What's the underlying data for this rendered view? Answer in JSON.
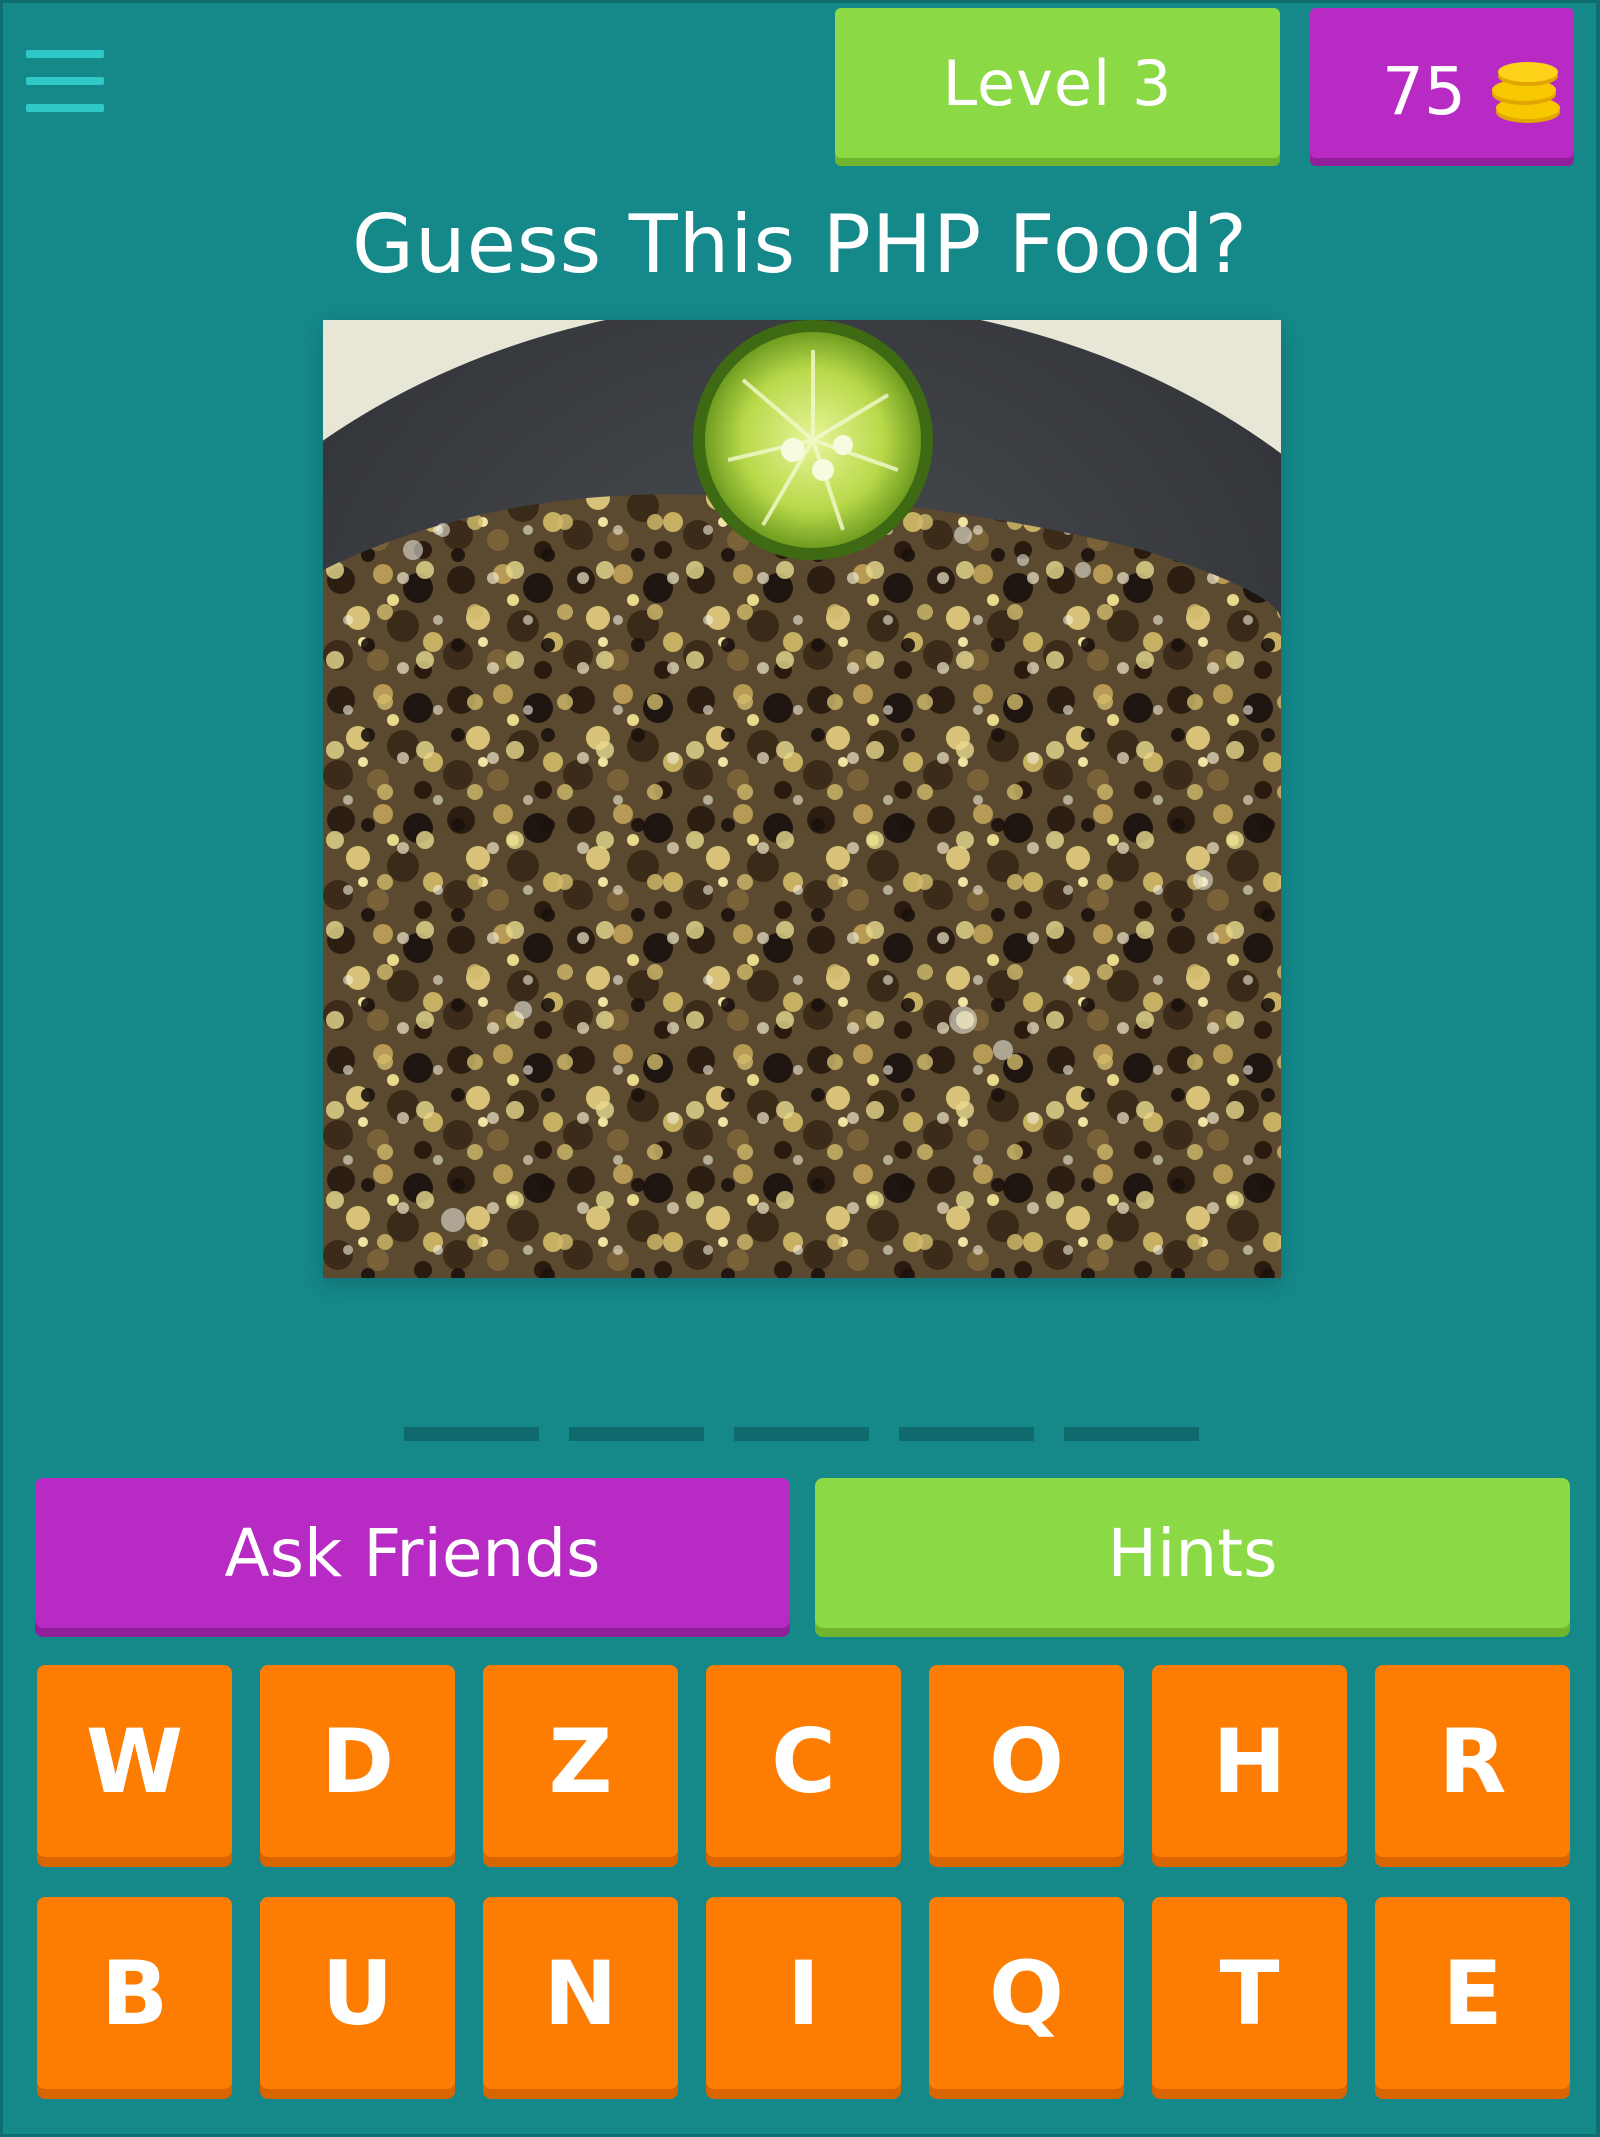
{
  "header": {
    "menu_icon": "hamburger-menu-icon",
    "level_label": "Level 3",
    "coins": "75",
    "coin_icon": "coin-stack-icon"
  },
  "question": "Guess This PHP Food?",
  "image": {
    "subject": "sizzling plate of food with calamansi"
  },
  "answer": {
    "slots": 5
  },
  "actions": {
    "ask_friends_label": "Ask Friends",
    "hints_label": "Hints"
  },
  "keyboard": {
    "row1": [
      "W",
      "D",
      "Z",
      "C",
      "O",
      "H",
      "R"
    ],
    "row2": [
      "B",
      "U",
      "N",
      "I",
      "Q",
      "T",
      "E"
    ]
  },
  "colors": {
    "background": "#15888a",
    "green": "#8bd945",
    "purple": "#b72ac3",
    "orange": "#fd7c02",
    "menu": "#2ec8c7",
    "coin": "#f7c700"
  }
}
